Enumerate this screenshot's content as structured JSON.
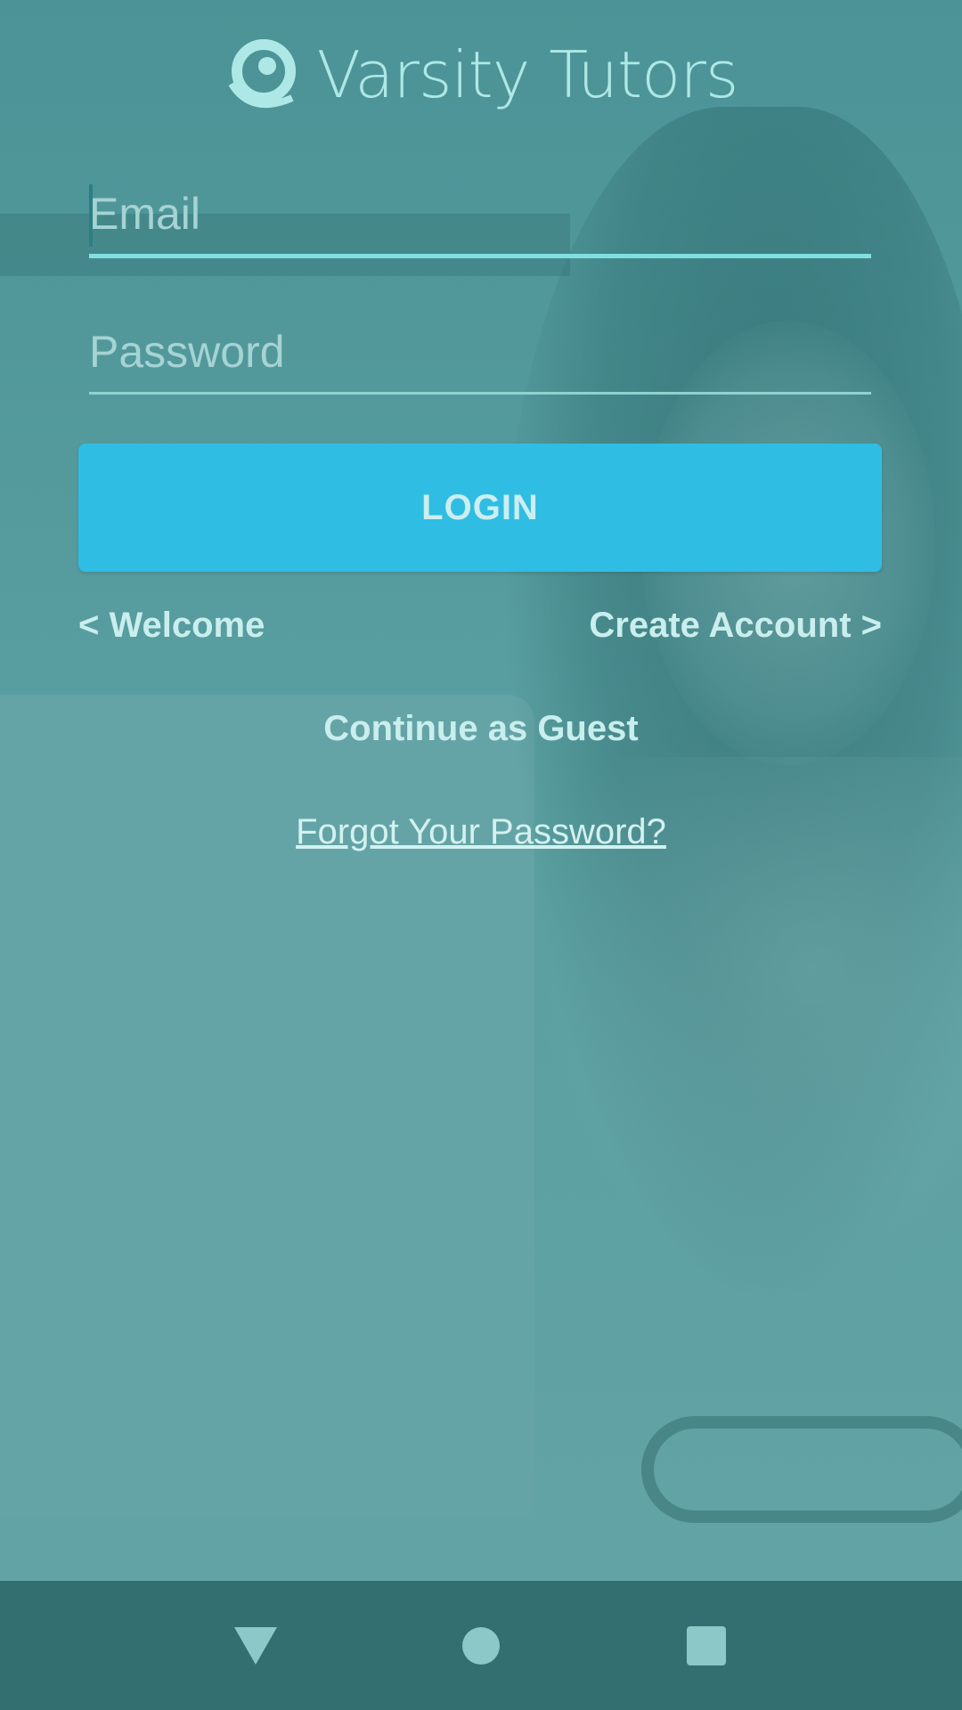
{
  "app": {
    "brand_name": "Varsity Tutors"
  },
  "form": {
    "email_placeholder": "Email",
    "email_value": "",
    "password_placeholder": "Password",
    "password_value": "",
    "login_label": "LOGIN"
  },
  "links": {
    "welcome": "< Welcome",
    "create_account": "Create Account >",
    "guest": "Continue as Guest",
    "forgot_password": "Forgot Your Password?"
  },
  "navbar": {
    "back_icon": "back-triangle-icon",
    "home_icon": "home-circle-icon",
    "recents_icon": "recents-square-icon"
  },
  "colors": {
    "overlay": "#4d9597",
    "accent_button": "#2fbde3",
    "navbar": "#336e70",
    "logo": "#aee8e6"
  }
}
